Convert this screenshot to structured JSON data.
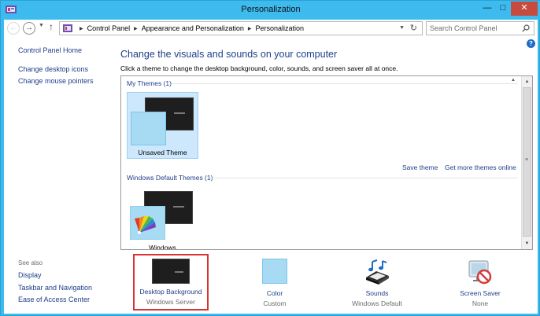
{
  "window": {
    "title": "Personalization",
    "minimize_glyph": "—",
    "maximize_glyph": "□",
    "close_glyph": "✕"
  },
  "address": {
    "crumbs": [
      "Control Panel",
      "Appearance and Personalization",
      "Personalization"
    ],
    "search_placeholder": "Search Control Panel"
  },
  "left_pane": {
    "home": "Control Panel Home",
    "links": [
      "Change desktop icons",
      "Change mouse pointers"
    ],
    "see_also_title": "See also",
    "see_also": [
      "Display",
      "Taskbar and Navigation",
      "Ease of Access Center"
    ]
  },
  "main": {
    "heading": "Change the visuals and sounds on your computer",
    "subheading": "Click a theme to change the desktop background, color, sounds, and screen saver all at once.",
    "my_themes_title": "My Themes (1)",
    "unsaved_theme": "Unsaved Theme",
    "save_theme": "Save theme",
    "get_more": "Get more themes online",
    "default_themes_title": "Windows Default Themes (1)",
    "windows_theme": "Windows"
  },
  "bottom": [
    {
      "label": "Desktop Background",
      "value": "Windows Server",
      "icon": "desktop-background-icon",
      "selected": true
    },
    {
      "label": "Color",
      "value": "Custom",
      "icon": "color-icon"
    },
    {
      "label": "Sounds",
      "value": "Windows Default",
      "icon": "sounds-icon"
    },
    {
      "label": "Screen Saver",
      "value": "None",
      "icon": "screen-saver-icon"
    }
  ],
  "colors": {
    "chrome": "#3dbbee",
    "link": "#1e3f8a",
    "highlight": "#d9322f",
    "theme_selected": "#cde8fc"
  }
}
